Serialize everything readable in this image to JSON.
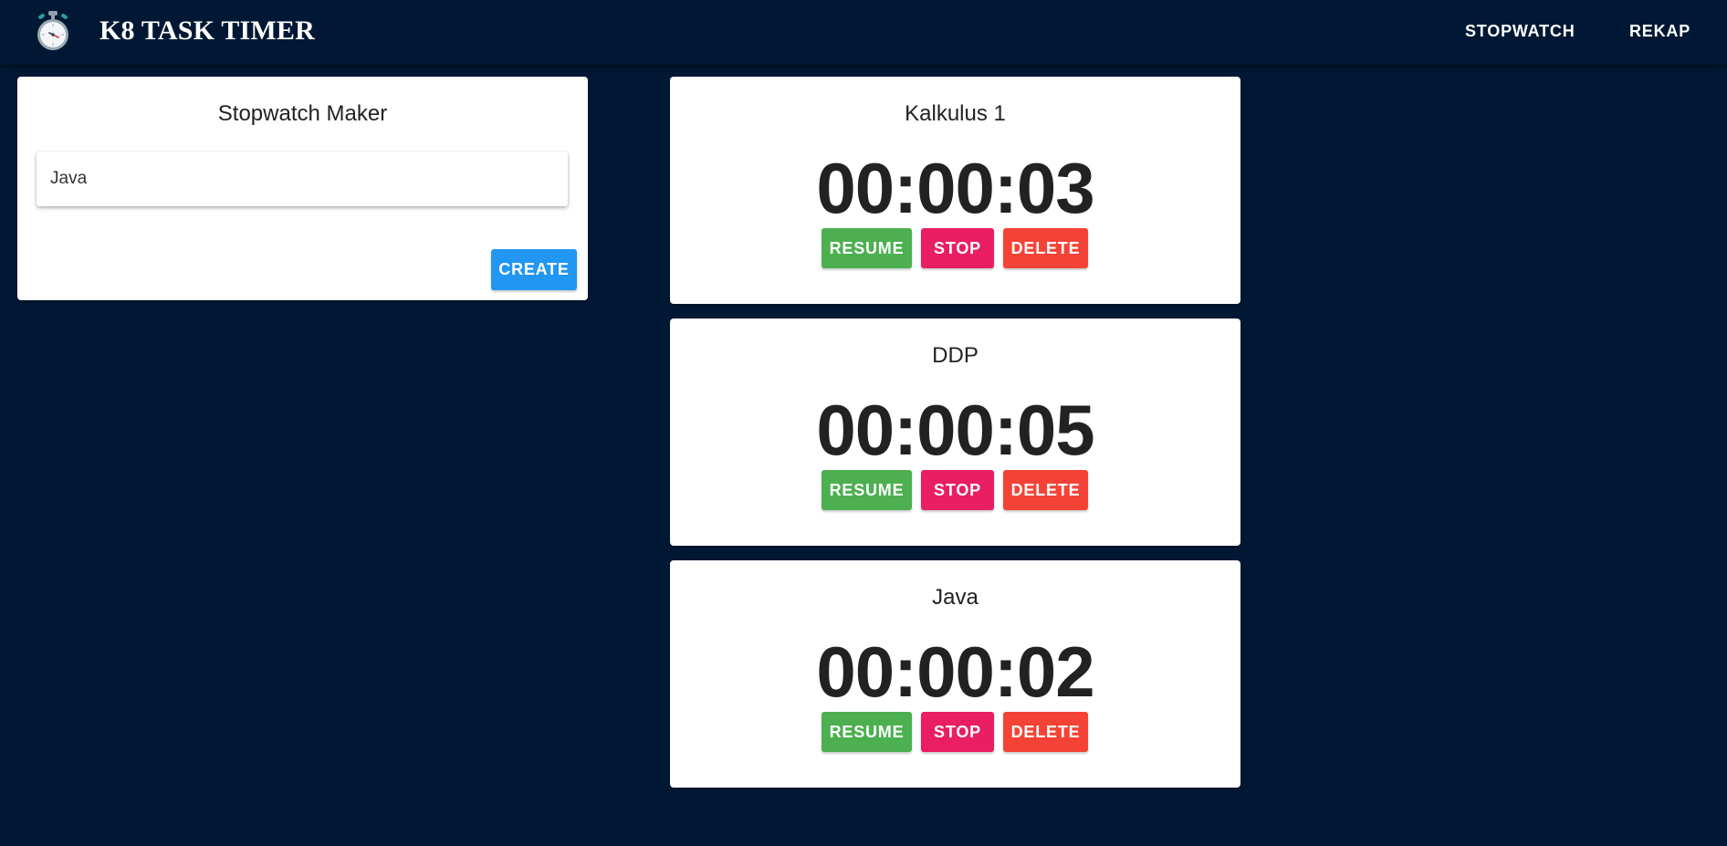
{
  "app": {
    "title": "K8 TASK TIMER",
    "logo_icon": "stopwatch-icon"
  },
  "nav": {
    "items": [
      {
        "label": "STOPWATCH"
      },
      {
        "label": "REKAP"
      }
    ]
  },
  "maker": {
    "title": "Stopwatch Maker",
    "input_value": "Java",
    "create_label": "CREATE"
  },
  "timers": [
    {
      "name": "Kalkulus 1",
      "time": "00:00:03",
      "resume_label": "RESUME",
      "stop_label": "STOP",
      "delete_label": "DELETE"
    },
    {
      "name": "DDP",
      "time": "00:00:05",
      "resume_label": "RESUME",
      "stop_label": "STOP",
      "delete_label": "DELETE"
    },
    {
      "name": "Java",
      "time": "00:00:02",
      "resume_label": "RESUME",
      "stop_label": "STOP",
      "delete_label": "DELETE"
    }
  ],
  "colors": {
    "background": "#001833",
    "card": "#ffffff",
    "create": "#2196f3",
    "resume": "#4caf50",
    "stop": "#e91e63",
    "delete": "#f44336",
    "text": "#222222"
  }
}
